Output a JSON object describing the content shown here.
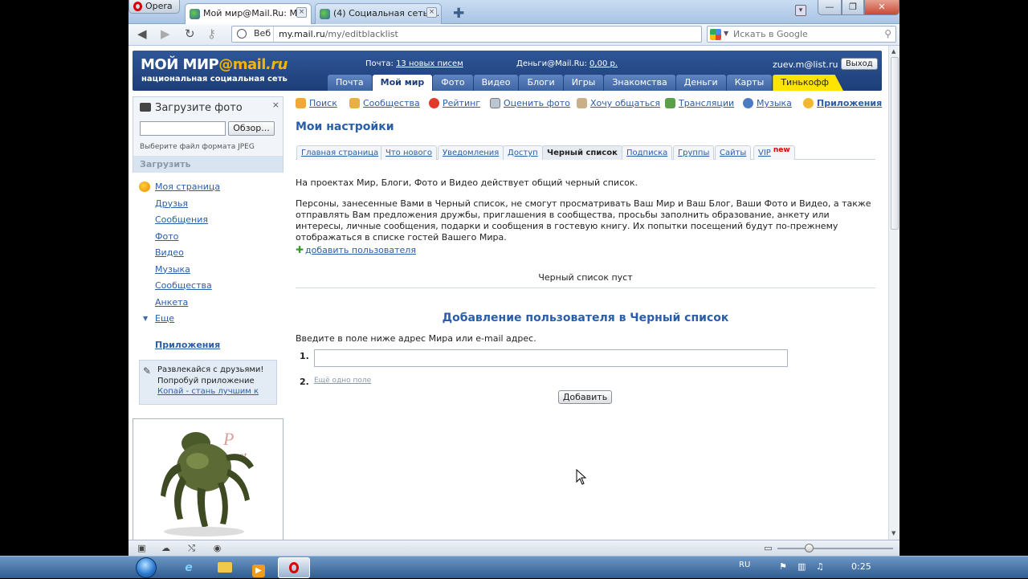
{
  "browser": {
    "menu_label": "Opera",
    "tabs": [
      {
        "label": "Мой мир@Mail.Ru: М...",
        "active": true
      },
      {
        "label": "(4) Социальная сеть ...",
        "active": false
      }
    ],
    "address": {
      "scope_label": "Веб",
      "url_host": "my.mail.ru",
      "url_path": "/my/editblacklist"
    },
    "search_placeholder": "Искать в Google"
  },
  "header": {
    "logo_main": "МОЙ МИР",
    "logo_at": "@mail",
    "logo_ru": ".ru",
    "slogan": "национальная социальная сеть",
    "mail_label": "Почта:",
    "mail_link": "13 новых писем",
    "money_label": "Деньги@Mail.Ru:",
    "money_link": "0,00 р.",
    "user_email": "zuev.m@list.ru",
    "logout_label": "Выход",
    "tabs": [
      "Почта",
      "Мой мир",
      "Фото",
      "Видео",
      "Блоги",
      "Игры",
      "Знакомства",
      "Деньги",
      "Карты",
      "Тинькофф"
    ]
  },
  "upload": {
    "title": "Загрузите фото",
    "close": "×",
    "browse_label": "Обзор...",
    "hint": "Выберите файл формата JPEG",
    "submit_label": "Загрузить"
  },
  "sidebar": {
    "items": [
      "Моя страница",
      "Друзья",
      "Сообщения",
      "Фото",
      "Видео",
      "Музыка",
      "Сообщества",
      "Анкета",
      "Еще"
    ],
    "apps_label": "Приложения",
    "promo_line1": "Развлекайся с друзьями!",
    "promo_line2": "Попробуй приложение",
    "promo_link": "Копай - стань лучшим к"
  },
  "quick_links": [
    "Поиск",
    "Сообщества",
    "Рейтинг",
    "Оценить фото",
    "Хочу общаться",
    "Трансляции",
    "Музыка",
    "Приложения"
  ],
  "settings": {
    "title": "Мои настройки",
    "tabs": [
      "Главная страница",
      "Что нового",
      "Уведомления",
      "Доступ",
      "Черный список",
      "Подписка",
      "Группы",
      "Сайты",
      "VIP"
    ],
    "new_badge": "new",
    "intro": "На проектах Мир, Блоги, Фото и Видео действует общий черный список.",
    "description": "Персоны, занесенные Вами в Черный список, не смогут просматривать Ваш Мир и Ваш Блог, Ваши Фото и Видео, а также отправлять Вам предложения дружбы, приглашения в сообщества, просьбы заполнить образование, анкету или интересы, личные сообщения, подарки и сообщения в гостевую книгу. Их попытки посещений будут по-прежнему отображаться в списке гостей Вашего Мира.",
    "add_user_link": "добавить пользователя",
    "empty_text": "Черный список пуст",
    "add_title": "Добавление пользователя в Черный список",
    "add_instructions": "Введите в поле ниже адрес Мира или e-mail адрес.",
    "field1_num": "1.",
    "field2_num": "2.",
    "one_more_field": "Ещё одно поле",
    "add_button": "Добавить"
  },
  "taskbar": {
    "lang": "RU",
    "time": "0:25"
  }
}
